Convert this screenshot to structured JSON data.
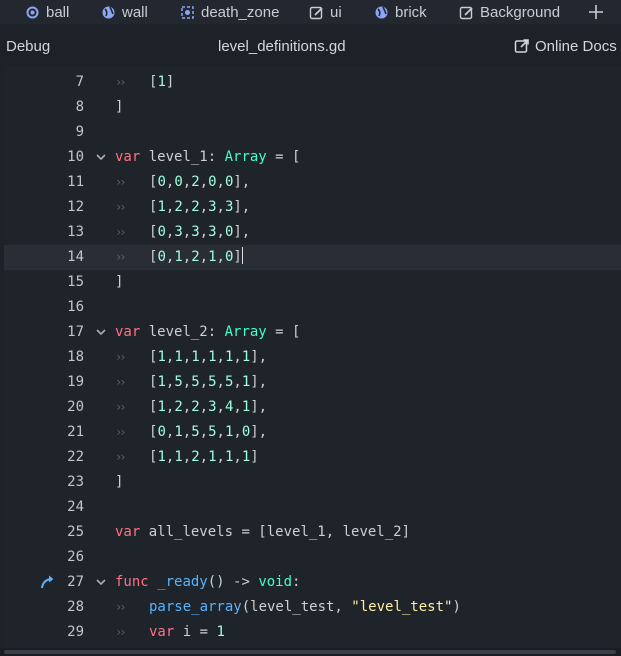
{
  "tabs": [
    {
      "label": "ball",
      "icon": "ball-node-icon"
    },
    {
      "label": "wall",
      "icon": "globe-icon"
    },
    {
      "label": "death_zone",
      "icon": "area-node-icon"
    },
    {
      "label": "ui",
      "icon": "control-node-icon"
    },
    {
      "label": "brick",
      "icon": "globe-icon"
    },
    {
      "label": "Background",
      "icon": "control-node-icon"
    }
  ],
  "toolbar": {
    "debug_label": "Debug",
    "file_name": "level_definitions.gd",
    "docs_label": "Online Docs"
  },
  "colors": {
    "keyword": "#ff7085",
    "type": "#42ffc2",
    "number": "#a1ffe0",
    "function": "#57b3ff",
    "string": "#ffeda1",
    "accent": "#57b3ff"
  },
  "editor": {
    "current_line": 14,
    "lines": [
      {
        "n": "7",
        "tokens": [
          {
            "t": "[",
            "c": ""
          },
          {
            "t": "1",
            "c": "num"
          },
          {
            "t": "]",
            "c": ""
          }
        ],
        "indent": true
      },
      {
        "n": "8",
        "tokens": [
          {
            "t": "]",
            "c": ""
          }
        ]
      },
      {
        "n": "9",
        "tokens": []
      },
      {
        "n": "10",
        "fold": true,
        "tokens": [
          {
            "t": "var",
            "c": "kw"
          },
          {
            "t": " level_1: ",
            "c": ""
          },
          {
            "t": "Array",
            "c": "ty"
          },
          {
            "t": " = [",
            "c": ""
          }
        ]
      },
      {
        "n": "11",
        "indent": true,
        "tokens": [
          {
            "t": "[",
            "c": ""
          },
          {
            "t": "0",
            "c": "num"
          },
          {
            "t": ",",
            "c": ""
          },
          {
            "t": "0",
            "c": "num"
          },
          {
            "t": ",",
            "c": ""
          },
          {
            "t": "2",
            "c": "num"
          },
          {
            "t": ",",
            "c": ""
          },
          {
            "t": "0",
            "c": "num"
          },
          {
            "t": ",",
            "c": ""
          },
          {
            "t": "0",
            "c": "num"
          },
          {
            "t": "],",
            "c": ""
          }
        ]
      },
      {
        "n": "12",
        "indent": true,
        "tokens": [
          {
            "t": "[",
            "c": ""
          },
          {
            "t": "1",
            "c": "num"
          },
          {
            "t": ",",
            "c": ""
          },
          {
            "t": "2",
            "c": "num"
          },
          {
            "t": ",",
            "c": ""
          },
          {
            "t": "2",
            "c": "num"
          },
          {
            "t": ",",
            "c": ""
          },
          {
            "t": "3",
            "c": "num"
          },
          {
            "t": ",",
            "c": ""
          },
          {
            "t": "3",
            "c": "num"
          },
          {
            "t": "],",
            "c": ""
          }
        ]
      },
      {
        "n": "13",
        "indent": true,
        "tokens": [
          {
            "t": "[",
            "c": ""
          },
          {
            "t": "0",
            "c": "num"
          },
          {
            "t": ",",
            "c": ""
          },
          {
            "t": "3",
            "c": "num"
          },
          {
            "t": ",",
            "c": ""
          },
          {
            "t": "3",
            "c": "num"
          },
          {
            "t": ",",
            "c": ""
          },
          {
            "t": "3",
            "c": "num"
          },
          {
            "t": ",",
            "c": ""
          },
          {
            "t": "0",
            "c": "num"
          },
          {
            "t": "],",
            "c": ""
          }
        ]
      },
      {
        "n": "14",
        "indent": true,
        "caret": true,
        "tokens": [
          {
            "t": "[",
            "c": ""
          },
          {
            "t": "0",
            "c": "num"
          },
          {
            "t": ",",
            "c": ""
          },
          {
            "t": "1",
            "c": "num"
          },
          {
            "t": ",",
            "c": ""
          },
          {
            "t": "2",
            "c": "num"
          },
          {
            "t": ",",
            "c": ""
          },
          {
            "t": "1",
            "c": "num"
          },
          {
            "t": ",",
            "c": ""
          },
          {
            "t": "0",
            "c": "num"
          },
          {
            "t": "]",
            "c": ""
          }
        ]
      },
      {
        "n": "15",
        "tokens": [
          {
            "t": "]",
            "c": ""
          }
        ]
      },
      {
        "n": "16",
        "tokens": []
      },
      {
        "n": "17",
        "fold": true,
        "tokens": [
          {
            "t": "var",
            "c": "kw"
          },
          {
            "t": " level_2: ",
            "c": ""
          },
          {
            "t": "Array",
            "c": "ty"
          },
          {
            "t": " = [",
            "c": ""
          }
        ]
      },
      {
        "n": "18",
        "indent": true,
        "tokens": [
          {
            "t": "[",
            "c": ""
          },
          {
            "t": "1",
            "c": "num"
          },
          {
            "t": ",",
            "c": ""
          },
          {
            "t": "1",
            "c": "num"
          },
          {
            "t": ",",
            "c": ""
          },
          {
            "t": "1",
            "c": "num"
          },
          {
            "t": ",",
            "c": ""
          },
          {
            "t": "1",
            "c": "num"
          },
          {
            "t": ",",
            "c": ""
          },
          {
            "t": "1",
            "c": "num"
          },
          {
            "t": ",",
            "c": ""
          },
          {
            "t": "1",
            "c": "num"
          },
          {
            "t": "],",
            "c": ""
          }
        ]
      },
      {
        "n": "19",
        "indent": true,
        "tokens": [
          {
            "t": "[",
            "c": ""
          },
          {
            "t": "1",
            "c": "num"
          },
          {
            "t": ",",
            "c": ""
          },
          {
            "t": "5",
            "c": "num"
          },
          {
            "t": ",",
            "c": ""
          },
          {
            "t": "5",
            "c": "num"
          },
          {
            "t": ",",
            "c": ""
          },
          {
            "t": "5",
            "c": "num"
          },
          {
            "t": ",",
            "c": ""
          },
          {
            "t": "5",
            "c": "num"
          },
          {
            "t": ",",
            "c": ""
          },
          {
            "t": "1",
            "c": "num"
          },
          {
            "t": "],",
            "c": ""
          }
        ]
      },
      {
        "n": "20",
        "indent": true,
        "tokens": [
          {
            "t": "[",
            "c": ""
          },
          {
            "t": "1",
            "c": "num"
          },
          {
            "t": ",",
            "c": ""
          },
          {
            "t": "2",
            "c": "num"
          },
          {
            "t": ",",
            "c": ""
          },
          {
            "t": "2",
            "c": "num"
          },
          {
            "t": ",",
            "c": ""
          },
          {
            "t": "3",
            "c": "num"
          },
          {
            "t": ",",
            "c": ""
          },
          {
            "t": "4",
            "c": "num"
          },
          {
            "t": ",",
            "c": ""
          },
          {
            "t": "1",
            "c": "num"
          },
          {
            "t": "],",
            "c": ""
          }
        ]
      },
      {
        "n": "21",
        "indent": true,
        "tokens": [
          {
            "t": "[",
            "c": ""
          },
          {
            "t": "0",
            "c": "num"
          },
          {
            "t": ",",
            "c": ""
          },
          {
            "t": "1",
            "c": "num"
          },
          {
            "t": ",",
            "c": ""
          },
          {
            "t": "5",
            "c": "num"
          },
          {
            "t": ",",
            "c": ""
          },
          {
            "t": "5",
            "c": "num"
          },
          {
            "t": ",",
            "c": ""
          },
          {
            "t": "1",
            "c": "num"
          },
          {
            "t": ",",
            "c": ""
          },
          {
            "t": "0",
            "c": "num"
          },
          {
            "t": "],",
            "c": ""
          }
        ]
      },
      {
        "n": "22",
        "indent": true,
        "tokens": [
          {
            "t": "[",
            "c": ""
          },
          {
            "t": "1",
            "c": "num"
          },
          {
            "t": ",",
            "c": ""
          },
          {
            "t": "1",
            "c": "num"
          },
          {
            "t": ",",
            "c": ""
          },
          {
            "t": "2",
            "c": "num"
          },
          {
            "t": ",",
            "c": ""
          },
          {
            "t": "1",
            "c": "num"
          },
          {
            "t": ",",
            "c": ""
          },
          {
            "t": "1",
            "c": "num"
          },
          {
            "t": ",",
            "c": ""
          },
          {
            "t": "1",
            "c": "num"
          },
          {
            "t": "]",
            "c": ""
          }
        ]
      },
      {
        "n": "23",
        "tokens": [
          {
            "t": "]",
            "c": ""
          }
        ]
      },
      {
        "n": "24",
        "tokens": []
      },
      {
        "n": "25",
        "tokens": [
          {
            "t": "var",
            "c": "kw"
          },
          {
            "t": " all_levels = [level_1, level_2]",
            "c": ""
          }
        ]
      },
      {
        "n": "26",
        "tokens": []
      },
      {
        "n": "27",
        "fold": true,
        "marker": true,
        "tokens": [
          {
            "t": "func",
            "c": "kw"
          },
          {
            "t": " ",
            "c": ""
          },
          {
            "t": "_ready",
            "c": "fn"
          },
          {
            "t": "() -> ",
            "c": ""
          },
          {
            "t": "void",
            "c": "ty"
          },
          {
            "t": ":",
            "c": ""
          }
        ]
      },
      {
        "n": "28",
        "indent": true,
        "tokens": [
          {
            "t": "parse_array",
            "c": "fn"
          },
          {
            "t": "(level_test, ",
            "c": ""
          },
          {
            "t": "\"level_test\"",
            "c": "str"
          },
          {
            "t": ")",
            "c": ""
          }
        ]
      },
      {
        "n": "29",
        "indent": true,
        "tokens": [
          {
            "t": "var",
            "c": "kw"
          },
          {
            "t": " i = ",
            "c": ""
          },
          {
            "t": "1",
            "c": "num"
          }
        ]
      }
    ]
  }
}
